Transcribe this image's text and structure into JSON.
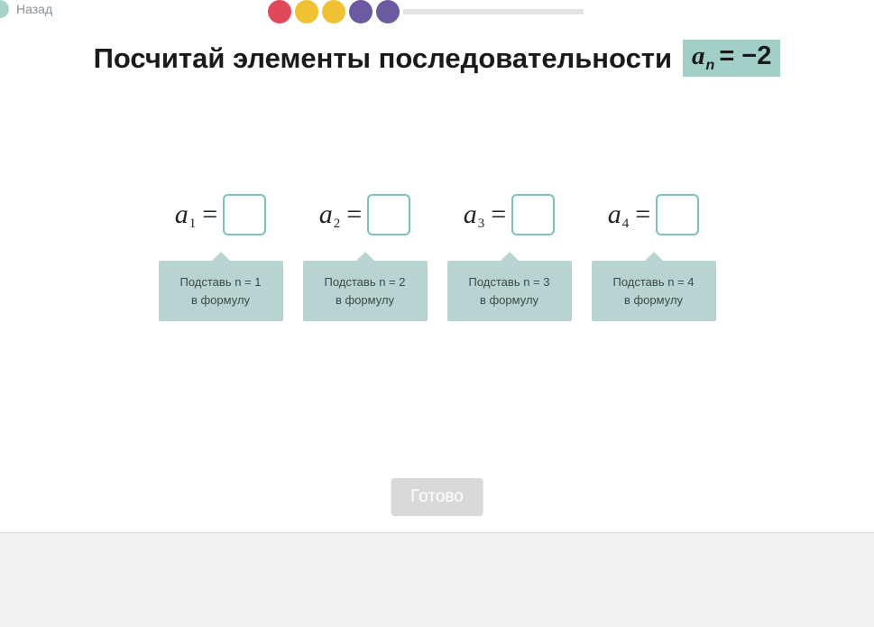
{
  "nav": {
    "back_label": "Назад"
  },
  "progress": {
    "dots": [
      {
        "color": "red"
      },
      {
        "color": "yellow"
      },
      {
        "color": "yellow"
      },
      {
        "color": "purple"
      },
      {
        "color": "purple"
      }
    ]
  },
  "title": "Посчитай элементы последовательности",
  "formula": {
    "var": "a",
    "sub": "n",
    "rest": "= −2"
  },
  "items": [
    {
      "var": "a",
      "sub": "1",
      "eq": "=",
      "value": "",
      "hint_line1": "Подставь n = 1",
      "hint_line2": "в формулу"
    },
    {
      "var": "a",
      "sub": "2",
      "eq": "=",
      "value": "",
      "hint_line1": "Подставь n = 2",
      "hint_line2": "в формулу"
    },
    {
      "var": "a",
      "sub": "3",
      "eq": "=",
      "value": "",
      "hint_line1": "Подставь n = 3",
      "hint_line2": "в формулу"
    },
    {
      "var": "a",
      "sub": "4",
      "eq": "=",
      "value": "",
      "hint_line1": "Подставь n = 4",
      "hint_line2": "в формулу"
    }
  ],
  "buttons": {
    "done": "Готово"
  }
}
